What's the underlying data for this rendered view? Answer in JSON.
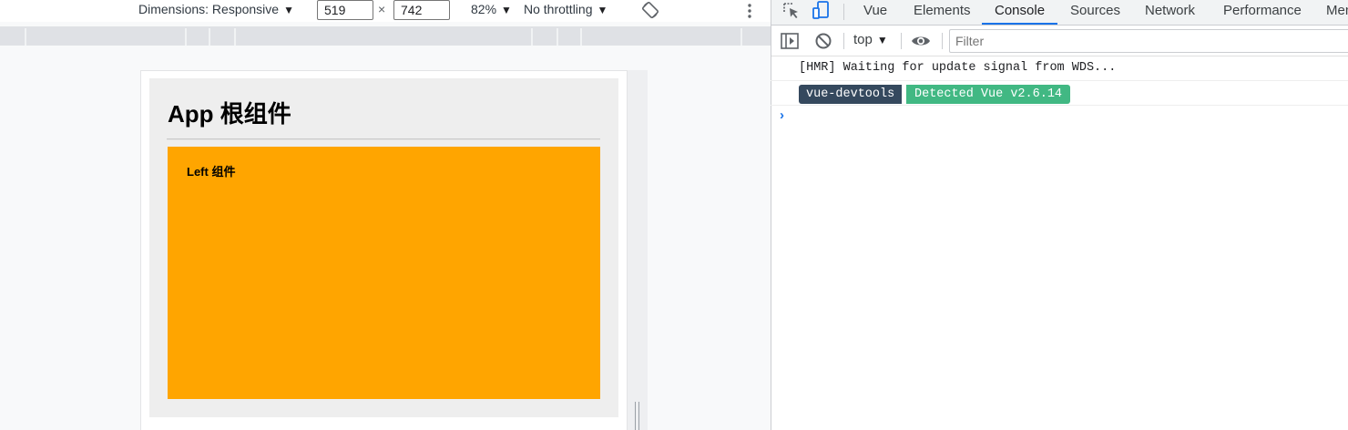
{
  "device_toolbar": {
    "dimensions_label": "Dimensions: Responsive",
    "width_value": "519",
    "height_value": "742",
    "times_glyph": "×",
    "zoom_label": "82%",
    "throttling_label": "No throttling",
    "caret_glyph": "▼"
  },
  "app_page": {
    "title": "App 根组件",
    "left_component_title": "Left 组件",
    "colors": {
      "app_bg": "#eeeeee",
      "left_bg": "#ffa500"
    }
  },
  "devtools": {
    "tabs": [
      {
        "label": "Vue"
      },
      {
        "label": "Elements"
      },
      {
        "label": "Console"
      },
      {
        "label": "Sources"
      },
      {
        "label": "Network"
      },
      {
        "label": "Performance"
      },
      {
        "label": "Mem"
      }
    ],
    "active_tab": "Console",
    "context_label": "top",
    "filter_placeholder": "Filter",
    "prompt_glyph": "›",
    "logs": {
      "hmr": "[HMR] Waiting for update signal from WDS...",
      "badge_left": "vue-devtools",
      "badge_right": "Detected Vue v2.6.14"
    },
    "colors": {
      "accent": "#1a73e8",
      "badge_dark": "#35495e",
      "badge_green": "#41b883"
    }
  }
}
